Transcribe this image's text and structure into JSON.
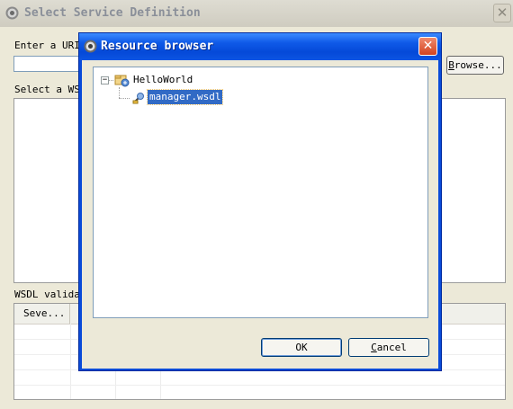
{
  "background_dialog": {
    "title": "Select Service Definition",
    "uri_label": "Enter a URI",
    "browse_label_prefix": "",
    "browse_label_mnemonic": "B",
    "browse_label_rest": "rowse...",
    "wsdl_list_label": "Select a WSD",
    "validation_label": "WSDL validat",
    "table_headers": [
      "Seve..."
    ]
  },
  "resource_browser": {
    "title": "Resource browser",
    "tree": {
      "project": "HelloWorld",
      "expander": "−",
      "file": "manager.wsdl"
    },
    "ok_label": "OK",
    "cancel_mnemonic": "C",
    "cancel_rest": "ancel"
  },
  "icons": {
    "window_icon": "gear-icon",
    "close": "close-icon",
    "project": "project-icon",
    "file": "wsdl-file-icon"
  },
  "colors": {
    "titlebar_active": "#0549d8",
    "selection": "#316ac5",
    "dialog_bg": "#ece9d8",
    "close_button": "#d3431f"
  }
}
